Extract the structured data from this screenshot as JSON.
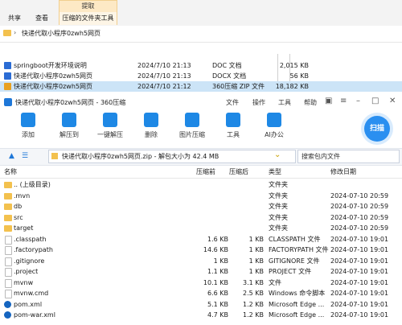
{
  "explorer": {
    "tabs": [
      "共享",
      "查看"
    ],
    "context_header": "提取",
    "context_tab": "压缩的文件夹工具",
    "address_path": "快递代取小程序0zwh5网页",
    "files": [
      {
        "name": "springboot开发环境说明",
        "date": "2024/7/10 21:13",
        "type": "DOC 文档",
        "size": "2,015 KB",
        "icon_color": "#2b6cd4"
      },
      {
        "name": "快递代取小程序0zwh5网页",
        "date": "2024/7/10 21:13",
        "type": "DOCX 文档",
        "size": "56 KB",
        "icon_color": "#2b6cd4"
      },
      {
        "name": "快递代取小程序0zwh5网页",
        "date": "2024/7/10 21:12",
        "type": "360压缩 ZIP 文件",
        "size": "18,182 KB",
        "icon_color": "#e8a020"
      }
    ]
  },
  "zip_window": {
    "title": "快递代取小程序0zwh5网页 - 360压缩",
    "menu": [
      "文件",
      "操作",
      "工具",
      "帮助"
    ],
    "toolbar": [
      {
        "label": "添加",
        "icon": "add-icon",
        "color": "#1e88e5"
      },
      {
        "label": "解压到",
        "icon": "extract-to-icon",
        "color": "#1e88e5"
      },
      {
        "label": "一键解压",
        "icon": "one-click-extract-icon",
        "color": "#1e88e5"
      },
      {
        "label": "删除",
        "icon": "delete-icon",
        "color": "#1e88e5"
      },
      {
        "label": "图片压缩",
        "icon": "image-compress-icon",
        "color": "#1e88e5"
      },
      {
        "label": "工具",
        "icon": "tools-icon",
        "color": "#1e88e5"
      },
      {
        "label": "AI办公",
        "icon": "ai-office-icon",
        "color": "#1e88e5"
      }
    ],
    "scan_label": "扫描",
    "path_text": "快递代取小程序0zwh5网页.zip - 解包大小为 42.4 MB",
    "search_placeholder": "搜索包内文件",
    "columns": {
      "name": "名称",
      "compressed": "压缩前",
      "packed": "压缩后",
      "type": "类型",
      "modified": "修改日期"
    },
    "rows": [
      {
        "name": ".. (上级目录)",
        "compressed": "",
        "packed": "",
        "type": "文件夹",
        "modified": "",
        "kind": "folder"
      },
      {
        "name": ".mvn",
        "compressed": "",
        "packed": "",
        "type": "文件夹",
        "modified": "2024-07-10 20:59",
        "kind": "folder"
      },
      {
        "name": "db",
        "compressed": "",
        "packed": "",
        "type": "文件夹",
        "modified": "2024-07-10 20:59",
        "kind": "folder"
      },
      {
        "name": "src",
        "compressed": "",
        "packed": "",
        "type": "文件夹",
        "modified": "2024-07-10 20:59",
        "kind": "folder"
      },
      {
        "name": "target",
        "compressed": "",
        "packed": "",
        "type": "文件夹",
        "modified": "2024-07-10 20:59",
        "kind": "folder"
      },
      {
        "name": ".classpath",
        "compressed": "1.6 KB",
        "packed": "1 KB",
        "type": "CLASSPATH 文件",
        "modified": "2024-07-10 19:01",
        "kind": "file"
      },
      {
        "name": ".factorypath",
        "compressed": "14.6 KB",
        "packed": "1 KB",
        "type": "FACTORYPATH 文件",
        "modified": "2024-07-10 19:01",
        "kind": "file"
      },
      {
        "name": ".gitignore",
        "compressed": "1 KB",
        "packed": "1 KB",
        "type": "GITIGNORE 文件",
        "modified": "2024-07-10 19:01",
        "kind": "file"
      },
      {
        "name": ".project",
        "compressed": "1.1 KB",
        "packed": "1 KB",
        "type": "PROJECT 文件",
        "modified": "2024-07-10 19:01",
        "kind": "file"
      },
      {
        "name": "mvnw",
        "compressed": "10.1 KB",
        "packed": "3.1 KB",
        "type": "文件",
        "modified": "2024-07-10 19:01",
        "kind": "file"
      },
      {
        "name": "mvnw.cmd",
        "compressed": "6.6 KB",
        "packed": "2.5 KB",
        "type": "Windows 命令脚本",
        "modified": "2024-07-10 19:01",
        "kind": "file"
      },
      {
        "name": "pom.xml",
        "compressed": "5.1 KB",
        "packed": "1.2 KB",
        "type": "Microsoft Edge ...",
        "modified": "2024-07-10 19:01",
        "kind": "edge"
      },
      {
        "name": "pom-war.xml",
        "compressed": "4.7 KB",
        "packed": "1.2 KB",
        "type": "Microsoft Edge ...",
        "modified": "2024-07-10 19:01",
        "kind": "edge"
      }
    ]
  }
}
